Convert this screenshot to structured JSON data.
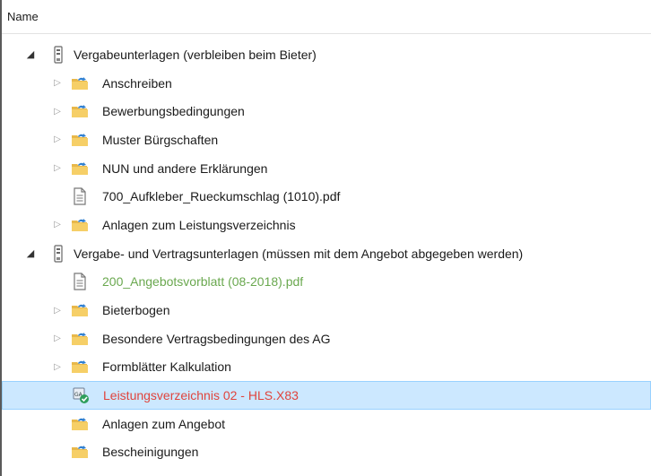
{
  "header": {
    "name_col": "Name"
  },
  "tree": [
    {
      "label": "Vergabeunterlagen (verbleiben beim Bieter)",
      "level": 0,
      "expander": "open",
      "icon": "group-icon"
    },
    {
      "label": "Anschreiben",
      "level": 1,
      "expander": "closed",
      "icon": "folder-icon"
    },
    {
      "label": "Bewerbungsbedingungen",
      "level": 1,
      "expander": "closed",
      "icon": "folder-icon"
    },
    {
      "label": "Muster Bürgschaften",
      "level": 1,
      "expander": "closed",
      "icon": "folder-icon"
    },
    {
      "label": "NUN und andere Erklärungen",
      "level": 1,
      "expander": "closed",
      "icon": "folder-icon"
    },
    {
      "label": "700_Aufkleber_Rueckumschlag (1010).pdf",
      "level": 1,
      "expander": "none",
      "icon": "document-icon"
    },
    {
      "label": "Anlagen zum Leistungsverzeichnis",
      "level": 1,
      "expander": "closed",
      "icon": "folder-icon"
    },
    {
      "label": "Vergabe- und Vertragsunterlagen (müssen mit dem Angebot abgegeben werden)",
      "level": 0,
      "expander": "open",
      "icon": "group-icon"
    },
    {
      "label": "200_Angebotsvorblatt (08-2018).pdf",
      "level": 1,
      "expander": "none",
      "icon": "document-icon",
      "color": "green"
    },
    {
      "label": "Bieterbogen",
      "level": 1,
      "expander": "closed",
      "icon": "folder-icon"
    },
    {
      "label": "Besondere Vertragsbedingungen des AG",
      "level": 1,
      "expander": "closed",
      "icon": "folder-icon"
    },
    {
      "label": "Formblätter Kalkulation",
      "level": 1,
      "expander": "closed",
      "icon": "folder-icon"
    },
    {
      "label": "Leistungsverzeichnis 02 - HLS.X83",
      "level": 1,
      "expander": "none",
      "icon": "gaeb-file-check-icon",
      "color": "red",
      "selected": true
    },
    {
      "label": "Anlagen zum Angebot",
      "level": 1,
      "expander": "none",
      "icon": "folder-icon"
    },
    {
      "label": "Bescheinigungen",
      "level": 1,
      "expander": "none",
      "icon": "folder-icon"
    }
  ],
  "colors": {
    "green": "#6aa84f",
    "red": "#e0443c",
    "selection": "#cce8ff",
    "selection_border": "#99d1ff",
    "folder": "#f2c14e"
  }
}
